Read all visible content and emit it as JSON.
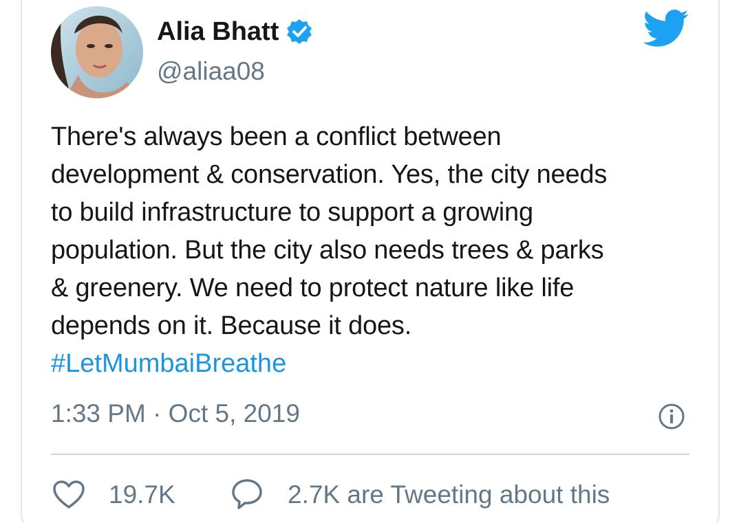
{
  "tweet": {
    "display_name": "Alia Bhatt",
    "handle": "@aliaa08",
    "text": "There's always been a conflict between\ndevelopment & conservation. Yes, the city needs\nto build infrastructure to support a growing\npopulation. But the city also needs trees & parks\n& greenery. We need to protect nature like life\ndepends on it. Because it does.",
    "hashtag": "#LetMumbaiBreathe",
    "timestamp": "1:33 PM · Oct 5, 2019",
    "likes": "19.7K",
    "tweeting_about": "2.7K are Tweeting about this"
  },
  "icons": {
    "verified": "verified-badge-icon",
    "brand": "twitter-bird-icon",
    "info": "info-icon",
    "like": "heart-icon",
    "reply": "speech-bubble-icon"
  },
  "colors": {
    "brand_blue": "#1da1f2",
    "link_blue": "#1b95e0",
    "secondary_text": "#657786",
    "divider": "#ccd6dd"
  }
}
